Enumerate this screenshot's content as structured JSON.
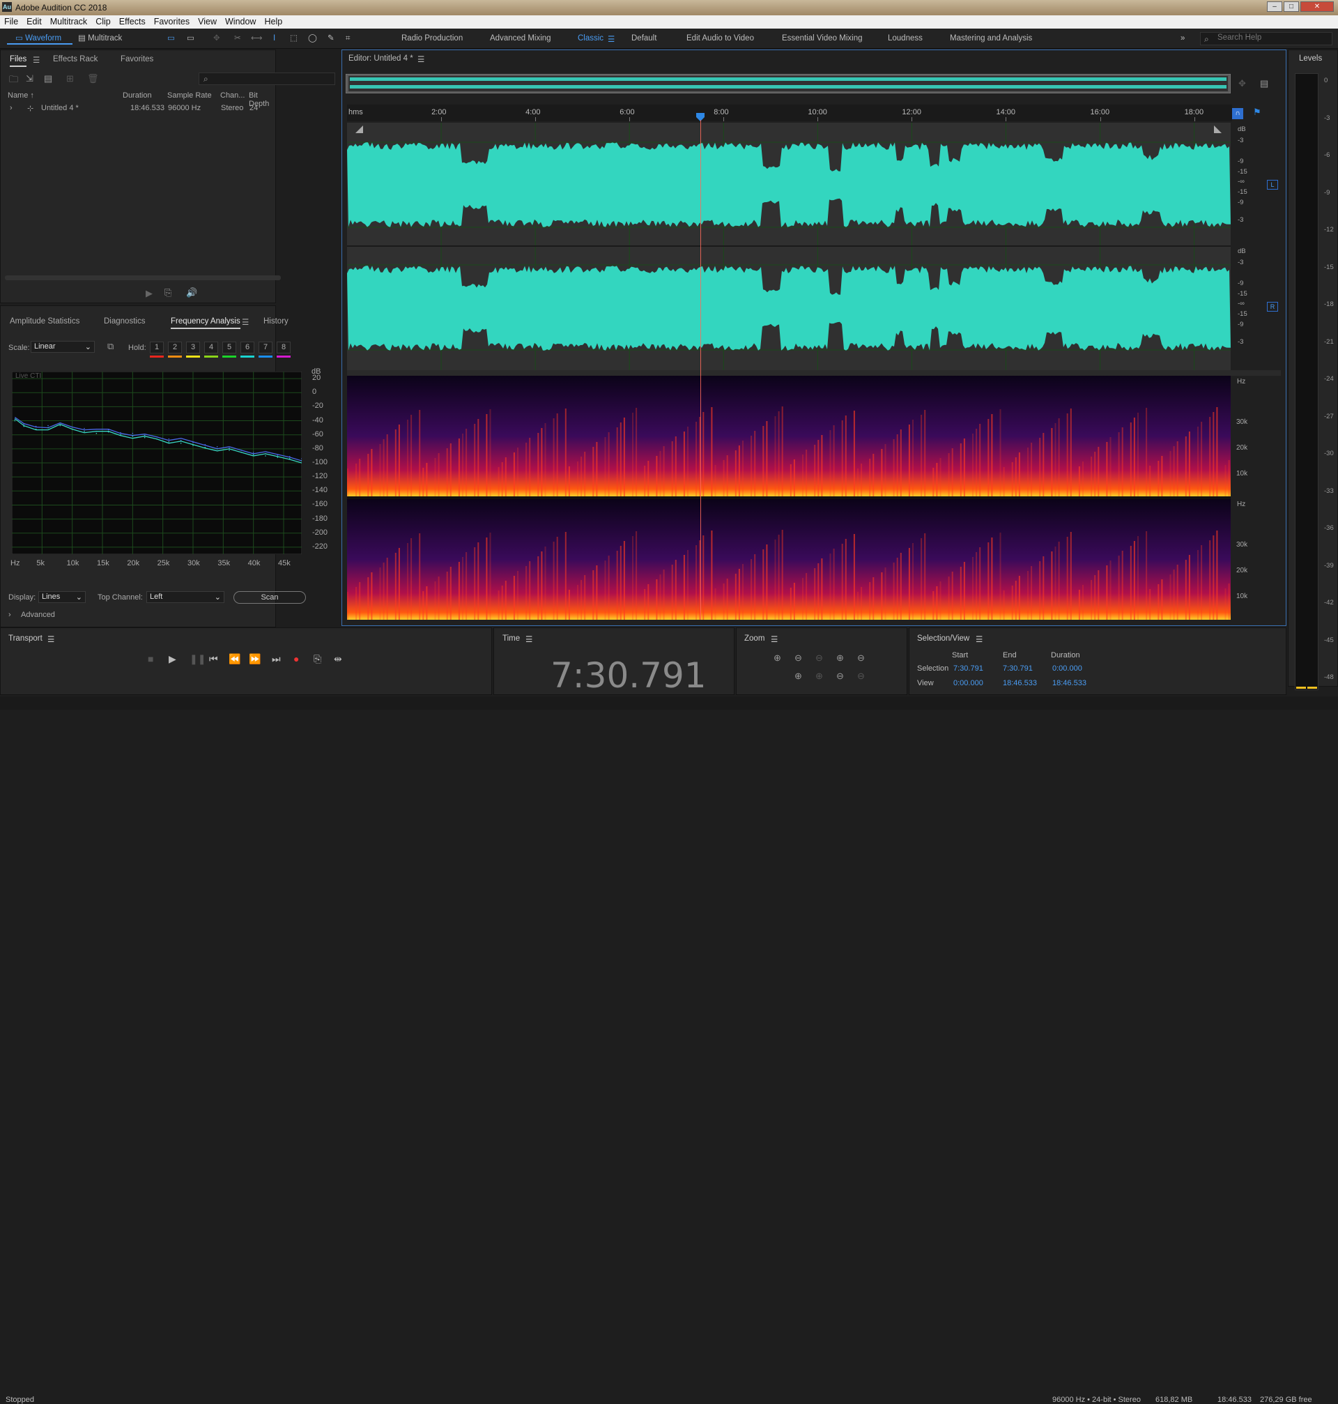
{
  "app": {
    "title": "Adobe Audition CC 2018",
    "logo": "Au"
  },
  "window_controls": {
    "min": "–",
    "max": "□",
    "close": "✕"
  },
  "menu": [
    "File",
    "Edit",
    "Multitrack",
    "Clip",
    "Effects",
    "Favorites",
    "View",
    "Window",
    "Help"
  ],
  "toolbar": {
    "waveform": "Waveform",
    "multitrack": "Multitrack",
    "search_placeholder": "Search Help",
    "workspaces": [
      "Radio Production",
      "Advanced Mixing",
      "Classic",
      "Default",
      "Edit Audio to Video",
      "Essential Video Mixing",
      "Loudness",
      "Mastering and Analysis"
    ],
    "active_workspace": "Classic"
  },
  "files_panel": {
    "tabs": [
      "Files",
      "Effects Rack",
      "Favorites"
    ],
    "columns": [
      "Name",
      "Duration",
      "Sample Rate",
      "Chan...",
      "Bit Depth"
    ],
    "rows": [
      {
        "name": "Untitled 4 *",
        "duration": "18:46.533",
        "sample_rate": "96000 Hz",
        "channels": "Stereo",
        "bit_depth": "24"
      }
    ]
  },
  "analysis_panel": {
    "tabs": [
      "Amplitude Statistics",
      "Diagnostics",
      "Frequency Analysis",
      "History"
    ],
    "scale_label": "Scale:",
    "scale_value": "Linear",
    "hold_label": "Hold:",
    "holds": [
      "1",
      "2",
      "3",
      "4",
      "5",
      "6",
      "7",
      "8"
    ],
    "hold_colors": [
      "#e8261e",
      "#f08c12",
      "#f3e318",
      "#8ad41a",
      "#1bd42a",
      "#1ad4d0",
      "#1a8ef0",
      "#d41ad0"
    ],
    "graph_caption": "Live CTI",
    "display_label": "Display:",
    "display_value": "Lines",
    "top_channel_label": "Top Channel:",
    "top_channel_value": "Left",
    "scan_button": "Scan",
    "advanced": "Advanced"
  },
  "chart_data": {
    "type": "line",
    "xlabel": "Hz",
    "ylabel": "dB",
    "x_ticks": [
      "5k",
      "10k",
      "15k",
      "20k",
      "25k",
      "30k",
      "35k",
      "40k",
      "45k"
    ],
    "y_ticks": [
      "20",
      "0",
      "-20",
      "-40",
      "-60",
      "-80",
      "-100",
      "-120",
      "-140",
      "-160",
      "-180",
      "-200",
      "-220"
    ],
    "ylim": [
      -230,
      30
    ],
    "xlim": [
      0,
      48000
    ],
    "series": [
      {
        "color": "#38d6c2",
        "x": [
          500,
          2000,
          4000,
          6000,
          8000,
          10000,
          12000,
          14000,
          16000,
          18000,
          20000,
          22000,
          24000,
          26000,
          28000,
          30000,
          32000,
          34000,
          36000,
          38000,
          40000,
          42000,
          44000,
          46000,
          48000
        ],
        "y": [
          -40,
          -48,
          -52,
          -50,
          -47,
          -52,
          -55,
          -58,
          -56,
          -60,
          -62,
          -64,
          -66,
          -70,
          -72,
          -75,
          -78,
          -80,
          -82,
          -85,
          -88,
          -90,
          -92,
          -94,
          -97
        ]
      },
      {
        "color": "#4a68e8",
        "x": [
          500,
          2000,
          4000,
          6000,
          8000,
          10000,
          12000,
          14000,
          16000,
          18000,
          20000,
          22000,
          24000,
          26000,
          28000,
          30000,
          32000,
          34000,
          36000,
          38000,
          40000,
          42000,
          44000,
          46000,
          48000
        ],
        "y": [
          -38,
          -45,
          -48,
          -47,
          -45,
          -49,
          -51,
          -55,
          -53,
          -57,
          -58,
          -61,
          -63,
          -66,
          -68,
          -71,
          -74,
          -77,
          -79,
          -82,
          -85,
          -87,
          -89,
          -91,
          -94
        ]
      }
    ]
  },
  "editor": {
    "title": "Editor: Untitled 4 *",
    "ruler_unit": "hms",
    "ruler_ticks": [
      "2:00",
      "4:00",
      "6:00",
      "8:00",
      "10:00",
      "12:00",
      "14:00",
      "16:00",
      "18:00"
    ],
    "db_scale": [
      "dB",
      "-3",
      "-9",
      "-15",
      "-∞",
      "-15",
      "-9",
      "-3"
    ],
    "channels": [
      "L",
      "R"
    ],
    "hz_label": "Hz",
    "hz_ticks": [
      "30k",
      "20k",
      "10k"
    ]
  },
  "levels": {
    "title": "Levels",
    "ticks": [
      "0",
      "-3",
      "-6",
      "-9",
      "-12",
      "-15",
      "-18",
      "-21",
      "-24",
      "-27",
      "-30",
      "-33",
      "-36",
      "-39",
      "-42",
      "-45",
      "-48"
    ]
  },
  "transport": {
    "title": "Transport"
  },
  "time": {
    "title": "Time",
    "value": "7:30.791"
  },
  "zoom": {
    "title": "Zoom"
  },
  "selection_view": {
    "title": "Selection/View",
    "headers": [
      "Start",
      "End",
      "Duration"
    ],
    "rows": [
      {
        "label": "Selection",
        "start": "7:30.791",
        "end": "7:30.791",
        "duration": "0:00.000"
      },
      {
        "label": "View",
        "start": "0:00.000",
        "end": "18:46.533",
        "duration": "18:46.533"
      }
    ]
  },
  "status": {
    "state": "Stopped",
    "format": "96000 Hz • 24-bit • Stereo",
    "size": "618,82 MB",
    "length": "18:46.533",
    "free": "276,29 GB free"
  }
}
